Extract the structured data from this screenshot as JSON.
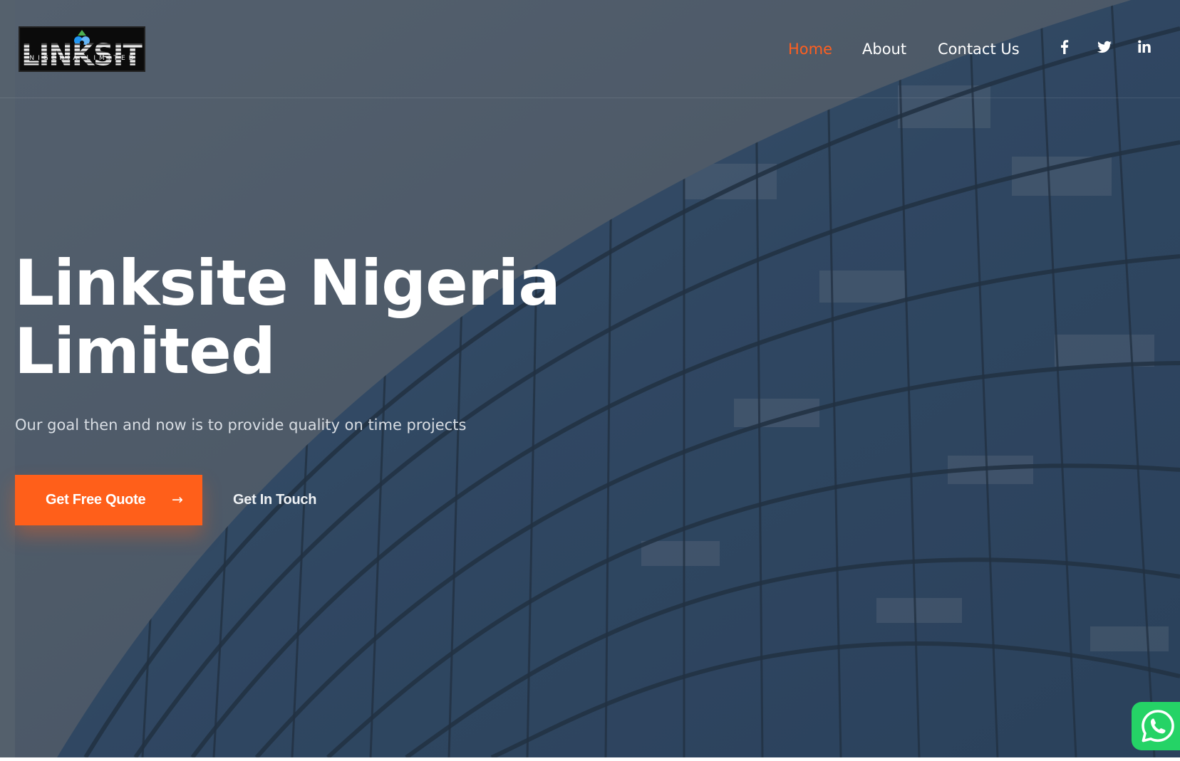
{
  "brand": {
    "logo_word": "LINKSITE",
    "logo_tagline": "NIGERIA LIMITED",
    "accent_color": "#ff5f1a"
  },
  "nav": {
    "items": [
      {
        "label": "Home",
        "active": true
      },
      {
        "label": "About",
        "active": false
      },
      {
        "label": "Contact Us",
        "active": false
      }
    ]
  },
  "social": {
    "icons": [
      "facebook-icon",
      "twitter-icon",
      "linkedin-icon"
    ]
  },
  "hero": {
    "title_line1": "Linksite Nigeria",
    "title_line2": "Limited",
    "subtitle": "Our goal then and now is to provide quality on time projects",
    "primary_button": "Get Free Quote",
    "primary_button_icon": "arrow-right-icon",
    "secondary_button": "Get In Touch"
  },
  "floating": {
    "whatsapp_icon": "whatsapp-icon"
  }
}
